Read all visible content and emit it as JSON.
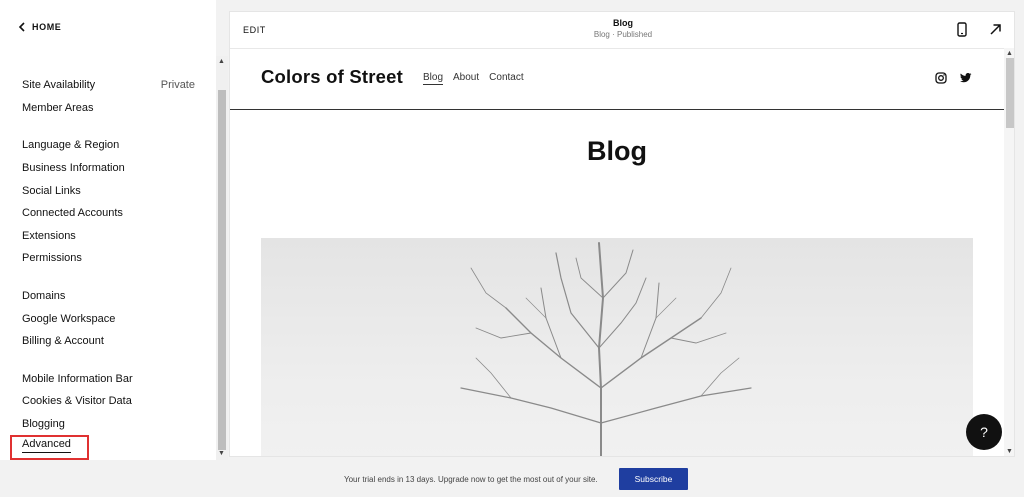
{
  "sidebar": {
    "home_label": "HOME",
    "groups": [
      [
        {
          "label": "Site Availability",
          "value": "Private"
        },
        {
          "label": "Member Areas"
        }
      ],
      [
        {
          "label": "Language & Region"
        },
        {
          "label": "Business Information"
        },
        {
          "label": "Social Links"
        },
        {
          "label": "Connected Accounts"
        },
        {
          "label": "Extensions"
        },
        {
          "label": "Permissions"
        }
      ],
      [
        {
          "label": "Domains"
        },
        {
          "label": "Google Workspace"
        },
        {
          "label": "Billing & Account"
        }
      ],
      [
        {
          "label": "Mobile Information Bar"
        },
        {
          "label": "Cookies & Visitor Data"
        },
        {
          "label": "Blogging"
        }
      ]
    ],
    "advanced_label": "Advanced",
    "highlight_color": "#e03131"
  },
  "preview": {
    "edit_label": "EDIT",
    "page_title": "Blog",
    "page_subtitle": "Blog · Published",
    "icons": [
      "mobile-icon",
      "expand-arrow-icon"
    ]
  },
  "site": {
    "title": "Colors of Street",
    "nav": [
      {
        "label": "Blog",
        "active": true
      },
      {
        "label": "About"
      },
      {
        "label": "Contact"
      }
    ],
    "social_icons": [
      "instagram-icon",
      "twitter-icon"
    ],
    "heading": "Blog"
  },
  "help": {
    "label": "?"
  },
  "trial": {
    "text": "Your trial ends in 13 days. Upgrade now to get the most out of your site.",
    "button_label": "Subscribe",
    "button_color": "#1f3ea0"
  }
}
